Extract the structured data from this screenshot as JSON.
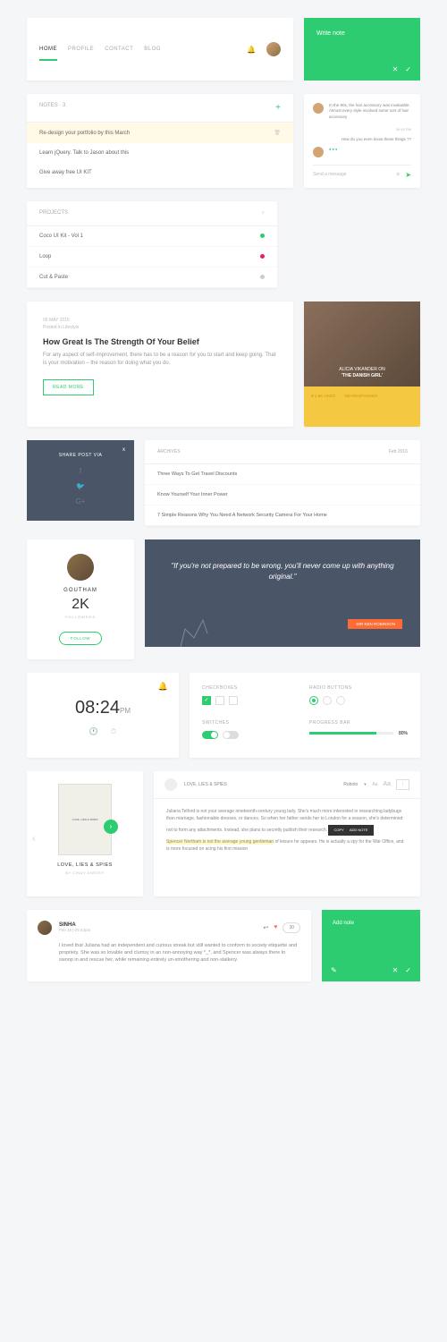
{
  "nav": {
    "items": [
      "HOME",
      "PROFILE",
      "CONTACT",
      "BLOG"
    ]
  },
  "writeNote": {
    "placeholder": "Write note"
  },
  "notes": {
    "title": "NOTES · 3",
    "items": [
      "Re-design your portfolio by this March",
      "Learn jQuery. Talk to Jason about this",
      "Give away free UI KIT"
    ]
  },
  "chat": {
    "msg1": "In the 90s, the hair accessory was invaluable. Almost every style involved some sort of hair accessory",
    "time": "06:40 PM",
    "reply": "How do you even know these things ??",
    "input": "Send a message"
  },
  "projects": {
    "title": "PROJECTS",
    "items": [
      {
        "name": "Coco UI Kit - Vol 1",
        "color": "g"
      },
      {
        "name": "Loop",
        "color": "p"
      },
      {
        "name": "Cut & Paste",
        "color": "gr"
      }
    ]
  },
  "article": {
    "date": "05 MAY 2015",
    "cat": "Posted in Lifestyle",
    "title": "How Great Is The Strength Of Your Belief",
    "body": "For any aspect of self-improvement, there has to be a reason for you to start and keep going. That is your motivation – the reason for doing what you do.",
    "btn": "READ MORE"
  },
  "profileImg": {
    "line1": "ALICIA VIKANDER ON",
    "line2": "'THE DANISH GIRL'",
    "likes": "2.6K LIKES",
    "responses": "900 RESPONSES"
  },
  "share": {
    "title": "SHARE POST VIA"
  },
  "archives": {
    "title": "ARCHIVES",
    "month": "Feb 2016",
    "items": [
      "Three Ways To Get Travel Discounts",
      "Know Yourself Your Inner Power",
      "7 Simple Reasons Why You Need A Network Security Camera For Your Home"
    ]
  },
  "follower": {
    "name": "GOUTHAM",
    "count": "2K",
    "label": "FOLLOWERS",
    "btn": "FOLLOW"
  },
  "quote": {
    "text": "\"If you're not prepared to be wrong, you'll never come up with anything original.\"",
    "author": "-SIR KEN ROBINSON"
  },
  "clock": {
    "time": "08:24",
    "ampm": "PM"
  },
  "controls": {
    "cb": "CHECKBOXES",
    "rb": "RADIO BUTTONS",
    "sw": "SWITCHES",
    "pb": "PROGRESS BAR",
    "pct": "80%"
  },
  "book": {
    "title": "LOVE, LIES & SPIES",
    "author": "BY CINDY ANSTEY",
    "coverTitle": "LOVE, LIES & SPIES"
  },
  "reader": {
    "title": "LOVE, LIES & SPIES",
    "font": "Roboto",
    "body1": "Juliana Telford is not your average nineteenth-century young lady. She's much more interested in researching ladybugs than marriage, fashionable dresses, or dances. So when her father sends her to London for a season, she's determined not to form any attachments. Instead, she plans to secretly publish their research.",
    "body2": "Spencer Northam is not the average young gentleman",
    "body3": " of leisure he appears. He is actually a spy for the War Office, and is more focused on acing his first mission",
    "copy": "COPY",
    "addnote": "ADD NOTE"
  },
  "comment": {
    "name": "SINHA",
    "date": "Feb 18 | 03:42pm",
    "count": "30",
    "body": "I loved that Juliana had an independent and curious streak but still wanted to conform to society etiquette and propriety. She was so lovable and clumsy in an non-annoying way *_*, and Spencer was always there to swoop in and rescue her, while remaining entirely un-smothering and non-stalkery."
  },
  "addNote": {
    "label": "Add note"
  }
}
